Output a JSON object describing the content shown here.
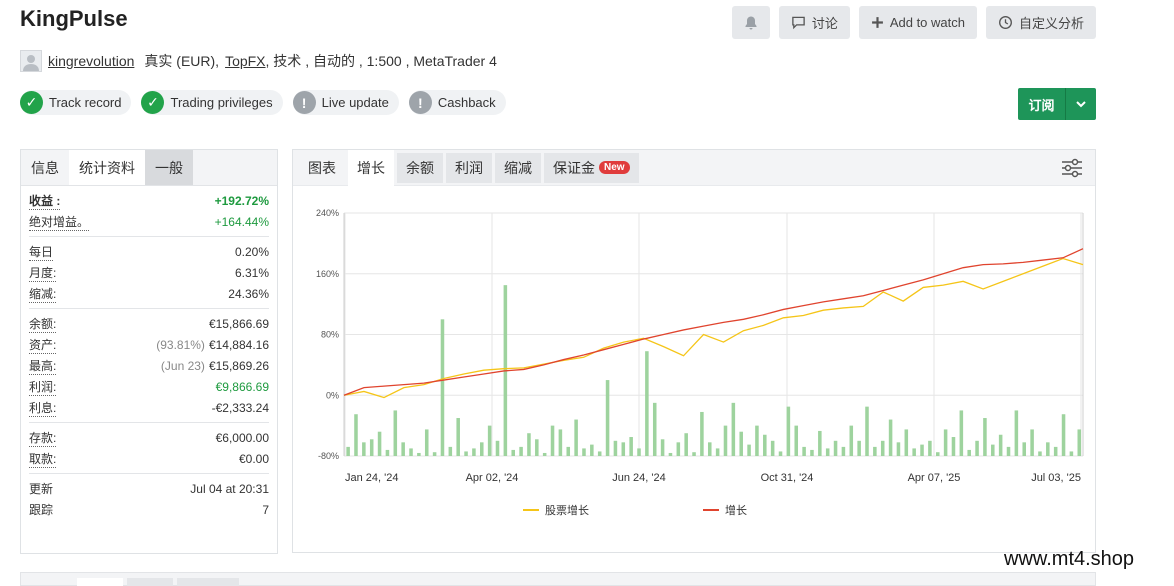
{
  "title": "KingPulse",
  "actions": {
    "bell_icon": "bell-icon",
    "discuss_label": "讨论",
    "watch_label": "Add to watch",
    "analysis_label": "自定义分析"
  },
  "owner": {
    "username": "kingrevolution",
    "account_type": "真实 (EUR),",
    "broker": "TopFX",
    "rest": ", 技术 , 自动的 , 1:500 , MetaTrader 4"
  },
  "badges": [
    {
      "label": "Track record",
      "status": "ok"
    },
    {
      "label": "Trading privileges",
      "status": "ok"
    },
    {
      "label": "Live update",
      "status": "warn"
    },
    {
      "label": "Cashback",
      "status": "warn"
    }
  ],
  "subscribe_label": "订阅",
  "left_tabs": [
    "信息",
    "统计资料",
    "一般"
  ],
  "stats": {
    "gain_label": "收益 :",
    "gain_value": "+192.72%",
    "abs_gain_label": "绝对增益。",
    "abs_gain_value": "+164.44%",
    "daily_label": "每日",
    "daily_value": "0.20%",
    "monthly_label": "月度:",
    "monthly_value": "6.31%",
    "drawdown_label": "缩减:",
    "drawdown_value": "24.36%",
    "balance_label": "余额:",
    "balance_value": "€15,866.69",
    "equity_label": "资产:",
    "equity_pct": "(93.81%)",
    "equity_value": "€14,884.16",
    "highest_label": "最高:",
    "highest_date": "(Jun 23)",
    "highest_value": "€15,869.26",
    "profit_label": "利润:",
    "profit_value": "€9,866.69",
    "interest_label": "利息:",
    "interest_value": "-€2,333.24",
    "deposits_label": "存款:",
    "deposits_value": "€6,000.00",
    "withdrawals_label": "取款:",
    "withdrawals_value": "€0.00",
    "updated_label": "更新",
    "updated_value": "Jul 04 at 20:31",
    "tracking_label": "跟踪",
    "tracking_value": "7"
  },
  "chart_tabs": [
    {
      "label": "图表",
      "style": "plain"
    },
    {
      "label": "增长",
      "style": "active"
    },
    {
      "label": "余额",
      "style": "normal"
    },
    {
      "label": "利润",
      "style": "normal"
    },
    {
      "label": "缩减",
      "style": "normal"
    },
    {
      "label": "保证金",
      "style": "normal",
      "badge": "New"
    }
  ],
  "watermark": "www.mt4.shop",
  "chart_data": {
    "type": "line",
    "x_tick_labels": [
      "Jan 24, '24",
      "Apr 02, '24",
      "Jun 24, '24",
      "Oct 31, '24",
      "Apr 07, '25",
      "Jul 03, '25"
    ],
    "y_tick_labels": [
      "240%",
      "160%",
      "80%",
      "0%",
      "-80%"
    ],
    "ylim": [
      -80,
      240
    ],
    "grid": true,
    "legend_position": "bottom",
    "series": [
      {
        "name": "股票增长",
        "color": "#f5c518",
        "x": [
          0,
          20,
          40,
          60,
          80,
          100,
          120,
          140,
          160,
          180,
          200,
          220,
          240,
          260,
          280,
          300,
          320,
          340,
          360,
          380,
          400,
          420,
          440,
          460,
          480,
          500,
          520,
          540,
          560,
          580,
          600,
          620,
          640,
          660,
          680,
          700,
          720,
          740
        ],
        "values": [
          0,
          5,
          -3,
          10,
          14,
          22,
          28,
          33,
          35,
          36,
          41,
          46,
          50,
          62,
          70,
          75,
          64,
          52,
          80,
          70,
          85,
          92,
          102,
          105,
          112,
          115,
          117,
          136,
          124,
          142,
          145,
          150,
          140,
          150,
          160,
          170,
          180,
          172
        ]
      },
      {
        "name": "增长",
        "color": "#e0442e",
        "x": [
          0,
          20,
          40,
          60,
          80,
          100,
          120,
          140,
          160,
          180,
          200,
          220,
          240,
          260,
          280,
          300,
          320,
          340,
          360,
          380,
          400,
          420,
          440,
          460,
          480,
          500,
          520,
          540,
          560,
          580,
          600,
          620,
          640,
          660,
          680,
          700,
          720,
          740
        ],
        "values": [
          0,
          10,
          12,
          14,
          16,
          20,
          24,
          28,
          32,
          34,
          40,
          47,
          53,
          60,
          67,
          74,
          80,
          86,
          91,
          96,
          100,
          106,
          113,
          118,
          123,
          127,
          131,
          138,
          145,
          152,
          160,
          168,
          172,
          173,
          175,
          178,
          181,
          193
        ]
      },
      {
        "name": "bars",
        "color": "#9ed39e",
        "values": [
          12,
          55,
          18,
          22,
          32,
          8,
          60,
          18,
          10,
          4,
          35,
          5,
          180,
          12,
          50,
          6,
          10,
          18,
          40,
          20,
          225,
          8,
          12,
          30,
          22,
          4,
          40,
          35,
          12,
          48,
          10,
          15,
          6,
          100,
          20,
          18,
          25,
          10,
          138,
          70,
          22,
          4,
          18,
          30,
          5,
          58,
          18,
          10,
          40,
          70,
          32,
          15,
          40,
          28,
          20,
          6,
          65,
          40,
          12,
          8,
          33,
          10,
          20,
          12,
          40,
          20,
          65,
          12,
          20,
          48,
          18,
          35,
          10,
          15,
          20,
          5,
          35,
          25,
          60,
          8,
          20,
          50,
          15,
          28,
          12,
          60,
          18,
          35,
          6,
          18,
          12,
          55,
          6,
          35
        ]
      }
    ]
  }
}
